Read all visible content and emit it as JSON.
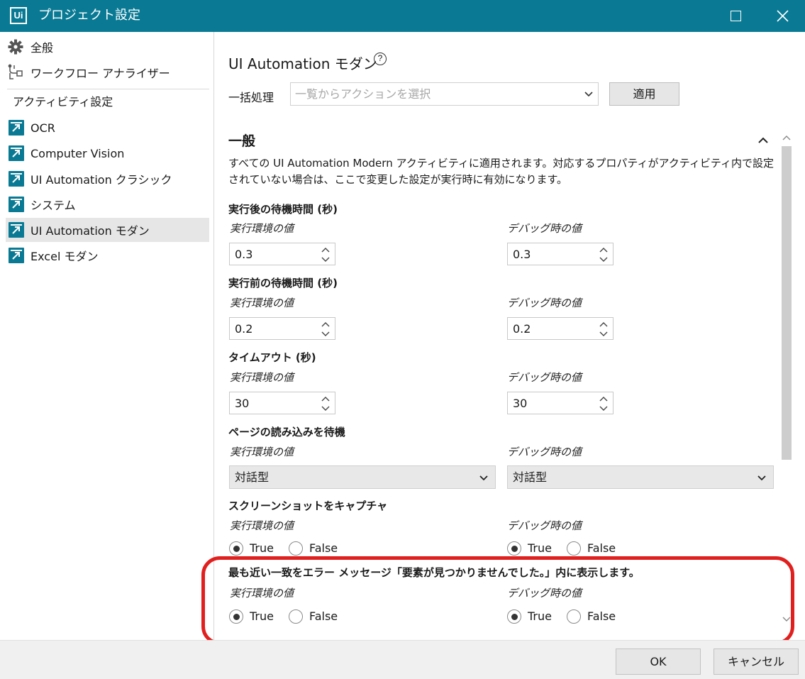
{
  "window": {
    "logo": "Ui",
    "title": "プロジェクト設定",
    "accent_color": "#0a7a94",
    "highlight_color": "#e0201f"
  },
  "sidebar": {
    "top_items": [
      {
        "label": "全般",
        "icon": "gear-icon"
      },
      {
        "label": "ワークフロー アナライザー",
        "icon": "workflow-analyzer-icon"
      }
    ],
    "group_label": "アクティビティ設定",
    "items": [
      {
        "label": "OCR",
        "active": false
      },
      {
        "label": "Computer Vision",
        "active": false
      },
      {
        "label": "UI Automation クラシック",
        "active": false
      },
      {
        "label": "システム",
        "active": false
      },
      {
        "label": "UI Automation モダン",
        "active": true
      },
      {
        "label": "Excel モダン",
        "active": false
      }
    ]
  },
  "main": {
    "title": "UI Automation モダン",
    "help_glyph": "?",
    "bulk": {
      "label": "一括処理",
      "placeholder": "一覧からアクションを選択",
      "apply_label": "適用"
    },
    "section": {
      "title": "一般",
      "description": "すべての UI Automation Modern アクティビティに適用されます。対応するプロパティがアクティビティ内で設定されていない場合は、ここで変更した設定が実行時に有効になります。"
    },
    "run_label": "実行環境の値",
    "debug_label": "デバッグ時の値",
    "properties": [
      {
        "title": "実行後の待機時間 (秒)",
        "run_value": "0.3",
        "debug_value": "0.3"
      },
      {
        "title": "実行前の待機時間 (秒)",
        "run_value": "0.2",
        "debug_value": "0.2"
      },
      {
        "title": "タイムアウト (秒)",
        "run_value": "30",
        "debug_value": "30"
      },
      {
        "title": "ページの読み込みを待機",
        "run_value": "対話型",
        "debug_value": "対話型"
      },
      {
        "title": "スクリーンショットをキャプチャ",
        "run_value": "True",
        "debug_value": "True"
      },
      {
        "title": "最も近い一致をエラー メッセージ「要素が見つかりませんでした。」内に表示します。",
        "run_value": "True",
        "debug_value": "True"
      }
    ],
    "true_label": "True",
    "false_label": "False"
  },
  "footer": {
    "ok_label": "OK",
    "cancel_label": "キャンセル"
  }
}
